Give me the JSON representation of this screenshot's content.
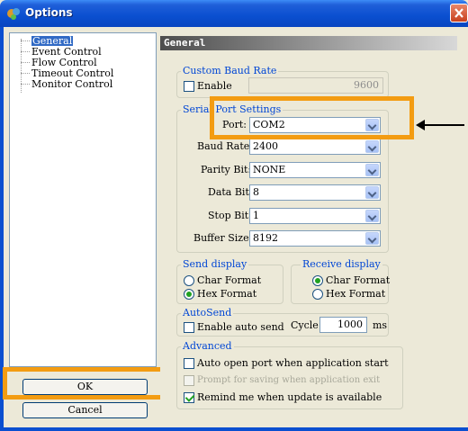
{
  "window": {
    "title": "Options"
  },
  "tree": {
    "items": [
      "General",
      "Event Control",
      "Flow Control",
      "Timeout Control",
      "Monitor Control"
    ]
  },
  "buttons": {
    "ok": "OK",
    "cancel": "Cancel"
  },
  "panel": {
    "header": "General"
  },
  "custom_baud": {
    "legend": "Custom Baud Rate",
    "enable_label": "Enable",
    "enabled": false,
    "value": "9600"
  },
  "serial": {
    "legend": "Serial Port Settings",
    "port_label": "Port:",
    "port_value": "COM2",
    "baud_label": "Baud Rate:",
    "baud_value": "2400",
    "parity_label": "Parity Bit:",
    "parity_value": "NONE",
    "data_label": "Data Bit:",
    "data_value": "8",
    "stop_label": "Stop Bit:",
    "stop_value": "1",
    "buffer_label": "Buffer Size:",
    "buffer_value": "8192"
  },
  "send_display": {
    "legend": "Send display",
    "char": "Char Format",
    "hex": "Hex Format",
    "selected": "hex"
  },
  "receive_display": {
    "legend": "Receive display",
    "char": "Char Format",
    "hex": "Hex  Format",
    "selected": "char"
  },
  "autosend": {
    "legend": "AutoSend",
    "enable_label": "Enable auto send",
    "enabled": false,
    "cycle_label": "Cycle",
    "cycle_value": "1000",
    "unit": "ms"
  },
  "advanced": {
    "legend": "Advanced",
    "auto_open": "Auto open port when application start",
    "auto_open_checked": false,
    "prompt_save": "Prompt for saving when application exit",
    "prompt_save_checked": false,
    "remind": "Remind me when update is available",
    "remind_checked": true
  },
  "colors": {
    "highlight": "#f39c12",
    "titlebar": "#0a4fd0",
    "legend_text": "#0046d5"
  }
}
